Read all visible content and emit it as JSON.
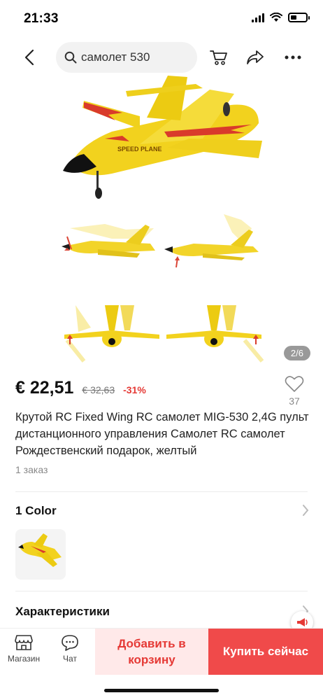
{
  "status_bar": {
    "time": "21:33"
  },
  "nav": {
    "search_value": "самолет 530",
    "icons": [
      "back-arrow-icon",
      "search-icon",
      "cart-icon",
      "share-icon",
      "more-icon"
    ]
  },
  "gallery": {
    "page_indicator": "2/6"
  },
  "product": {
    "price_current": "€ 22,51",
    "price_old": "€ 32,63",
    "discount": "-31%",
    "wishlist_count": "37",
    "title": "Крутой RC Fixed Wing RC самолет MIG-530 2,4G пульт дистанционного управления Самолет RC самолет Рождественский подарок, желтый",
    "orders": "1 заказ"
  },
  "variants": {
    "label": "1 Color"
  },
  "specs": {
    "label": "Характеристики"
  },
  "bottom_bar": {
    "store_label": "Магазин",
    "chat_label": "Чат",
    "add_to_cart": "Добавить в корзину",
    "buy_now": "Купить сейчас"
  },
  "colors": {
    "accent": "#f04a4a",
    "accent_light": "#ffe9e9",
    "plane_yellow": "#f2d21e"
  }
}
